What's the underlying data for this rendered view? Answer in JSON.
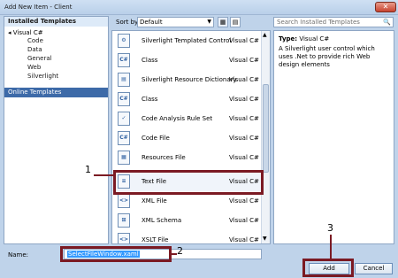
{
  "window": {
    "title": "Add New Item - Client",
    "close_glyph": "✕"
  },
  "left": {
    "installed_header": "Installed Templates",
    "root": "◂ Visual C#",
    "items": [
      "Code",
      "Data",
      "General",
      "Web",
      "Silverlight"
    ],
    "online": "Online Templates"
  },
  "toolbar": {
    "sort_label": "Sort by:",
    "sort_value": "Default",
    "search_placeholder": "Search Installed Templates",
    "view1_glyph": "▦",
    "view2_glyph": "▤",
    "search_glyph": "🔍"
  },
  "templates": [
    {
      "name": "Silverlight Templated Control",
      "lang": "Visual C#",
      "icon": "silverlight-control-icon",
      "glyph": "⚙"
    },
    {
      "name": "Class",
      "lang": "Visual C#",
      "icon": "csharp-class-icon",
      "glyph": "C#"
    },
    {
      "name": "Silverlight Resource Dictionary",
      "lang": "Visual C#",
      "icon": "resource-dictionary-icon",
      "glyph": "▤"
    },
    {
      "name": "Class",
      "lang": "Visual C#",
      "icon": "csharp-class-icon",
      "glyph": "C#"
    },
    {
      "name": "Code Analysis Rule Set",
      "lang": "Visual C#",
      "icon": "ruleset-icon",
      "glyph": "✓"
    },
    {
      "name": "Code File",
      "lang": "Visual C#",
      "icon": "code-file-icon",
      "glyph": "C#"
    },
    {
      "name": "Resources File",
      "lang": "Visual C#",
      "icon": "resources-file-icon",
      "glyph": "▦"
    },
    {
      "name": "Text File",
      "lang": "Visual C#",
      "icon": "text-file-icon",
      "glyph": "≡"
    },
    {
      "name": "XML File",
      "lang": "Visual C#",
      "icon": "xml-file-icon",
      "glyph": "<>"
    },
    {
      "name": "XML Schema",
      "lang": "Visual C#",
      "icon": "xml-schema-icon",
      "glyph": "⊞"
    },
    {
      "name": "XSLT File",
      "lang": "Visual C#",
      "icon": "xslt-file-icon",
      "glyph": "<>"
    }
  ],
  "info": {
    "type_label": "Type:",
    "type_value": "Visual C#",
    "description": "A Silverlight user control which uses .Net to provide rich Web design elements"
  },
  "bottom": {
    "name_label": "Name:",
    "name_value": "SelectFileWindow.xaml",
    "add_label": "Add",
    "cancel_label": "Cancel"
  },
  "callouts": [
    "1",
    "2",
    "3"
  ],
  "colors": {
    "callout": "#7b1a23",
    "selection": "#3d6aa8"
  }
}
